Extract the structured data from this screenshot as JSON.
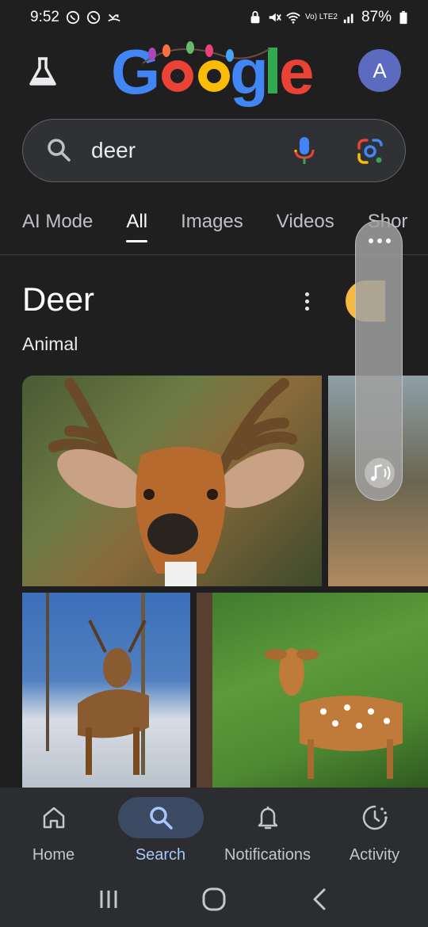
{
  "status_bar": {
    "time": "9:52",
    "battery": "87%",
    "network": "Vo) LTE2"
  },
  "header": {
    "logo_text": "Google",
    "avatar_letter": "A"
  },
  "search": {
    "query": "deer"
  },
  "tabs": [
    {
      "label": "AI Mode",
      "active": false
    },
    {
      "label": "All",
      "active": true
    },
    {
      "label": "Images",
      "active": false
    },
    {
      "label": "Videos",
      "active": false
    },
    {
      "label": "Shor",
      "active": false
    }
  ],
  "knowledge_panel": {
    "title": "Deer",
    "subtitle": "Animal"
  },
  "images": [
    {
      "subject": "white-tailed deer buck close-up"
    },
    {
      "subject": "deer partial"
    },
    {
      "subject": "deer in snowy forest"
    },
    {
      "subject": "spotted fallow deer in grass"
    }
  ],
  "bottom_nav": [
    {
      "label": "Home",
      "icon": "home-icon",
      "active": false
    },
    {
      "label": "Search",
      "icon": "search-icon",
      "active": true
    },
    {
      "label": "Notifications",
      "icon": "bell-icon",
      "active": false
    },
    {
      "label": "Activity",
      "icon": "activity-icon",
      "active": false
    }
  ],
  "colors": {
    "background": "#1f1f1f",
    "accent": "#a8c7fa",
    "active_pill": "#3c4a63",
    "avatar": "#5c6bc0"
  }
}
